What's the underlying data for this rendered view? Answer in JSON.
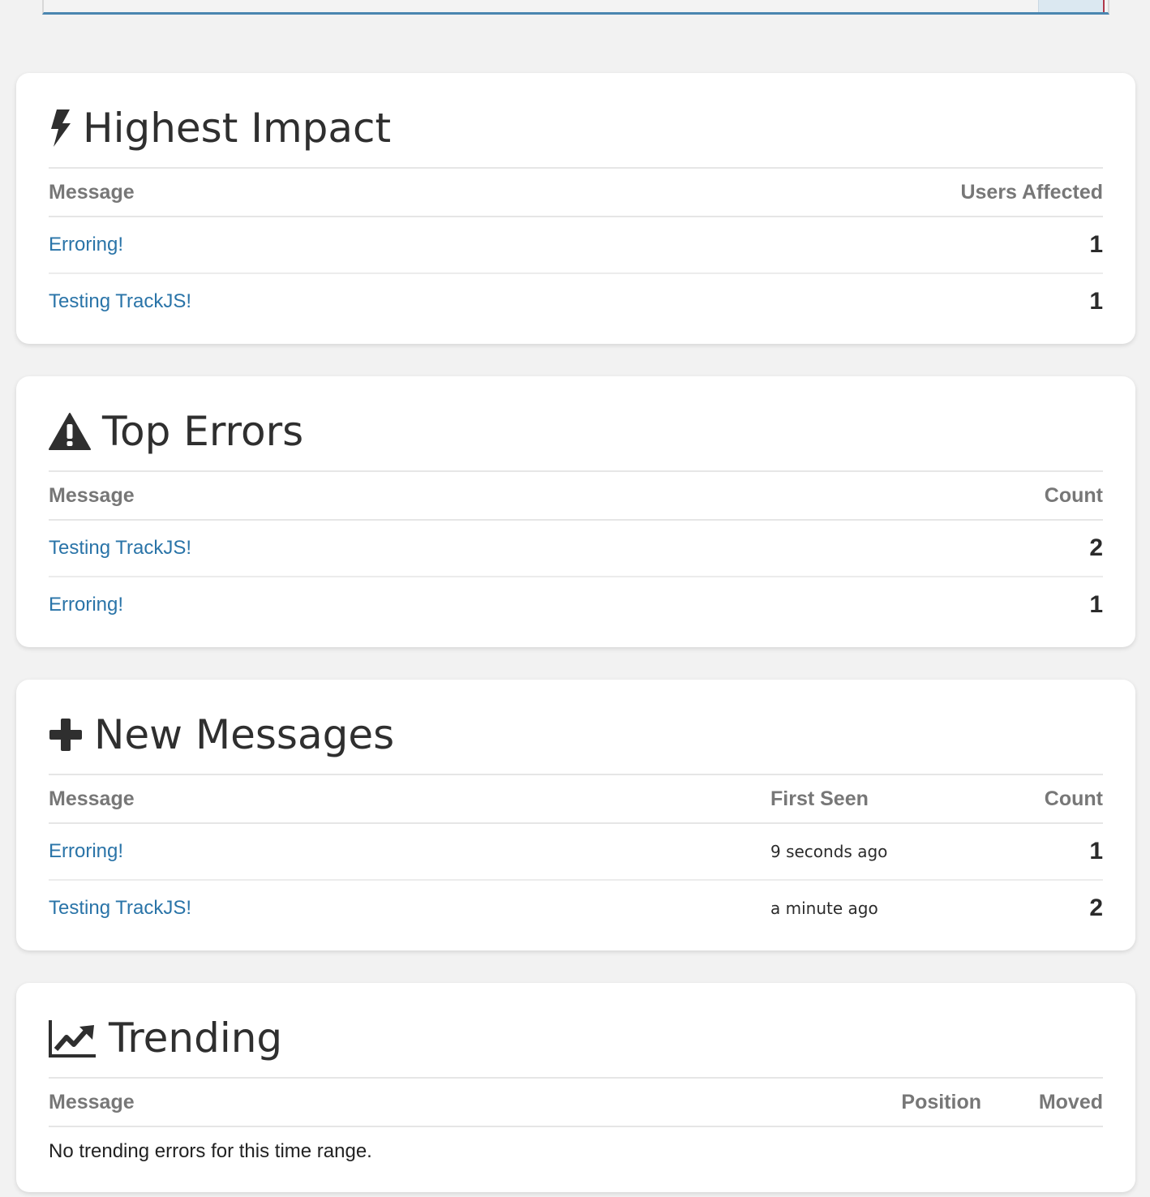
{
  "panels": {
    "highest_impact": {
      "title": "Highest Impact",
      "icon": "bolt-icon",
      "columns": [
        "Message",
        "Users Affected"
      ],
      "rows": [
        {
          "message": "Erroring!",
          "value": "1"
        },
        {
          "message": "Testing TrackJS!",
          "value": "1"
        }
      ]
    },
    "top_errors": {
      "title": "Top Errors",
      "icon": "warning-icon",
      "columns": [
        "Message",
        "Count"
      ],
      "rows": [
        {
          "message": "Testing TrackJS!",
          "value": "2"
        },
        {
          "message": "Erroring!",
          "value": "1"
        }
      ]
    },
    "new_messages": {
      "title": "New Messages",
      "icon": "plus-icon",
      "columns": [
        "Message",
        "First Seen",
        "Count"
      ],
      "rows": [
        {
          "message": "Erroring!",
          "first_seen": "9 seconds ago",
          "value": "1"
        },
        {
          "message": "Testing TrackJS!",
          "first_seen": "a minute ago",
          "value": "2"
        }
      ]
    },
    "trending": {
      "title": "Trending",
      "icon": "chart-line-icon",
      "columns": [
        "Message",
        "Position",
        "Moved"
      ],
      "empty_text": "No trending errors for this time range."
    }
  },
  "colors": {
    "link": "#2a74a8",
    "header_text": "#777777",
    "title_text": "#2f2f2f"
  }
}
